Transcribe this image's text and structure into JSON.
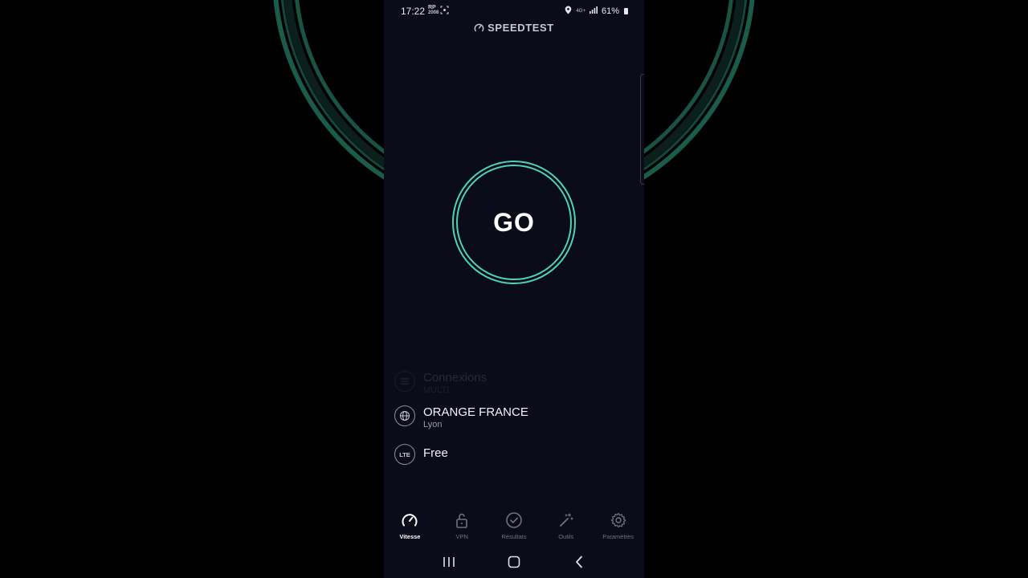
{
  "status_bar": {
    "time": "17:22",
    "left_indicator_top": "RP",
    "left_indicator_bottom": "2008",
    "network": "4G+",
    "battery": "61%"
  },
  "app": {
    "title": "SPEEDTEST",
    "go_label": "GO",
    "accent_color": "#4fd1b5"
  },
  "connections": {
    "title": "Connexions",
    "subtitle": "MULTI"
  },
  "provider": {
    "name": "ORANGE FRANCE",
    "location": "Lyon"
  },
  "network_type": {
    "icon_label": "LTE",
    "name": "Free"
  },
  "bottom_nav": [
    {
      "label": "Vitesse",
      "icon": "speedometer-icon",
      "active": true
    },
    {
      "label": "VPN",
      "icon": "unlock-icon",
      "active": false
    },
    {
      "label": "Résultats",
      "icon": "check-circle-icon",
      "active": false
    },
    {
      "label": "Outils",
      "icon": "magic-wand-icon",
      "active": false
    },
    {
      "label": "Paramètres",
      "icon": "gear-icon",
      "active": false
    }
  ],
  "system_nav": [
    "recent-apps",
    "home",
    "back"
  ]
}
